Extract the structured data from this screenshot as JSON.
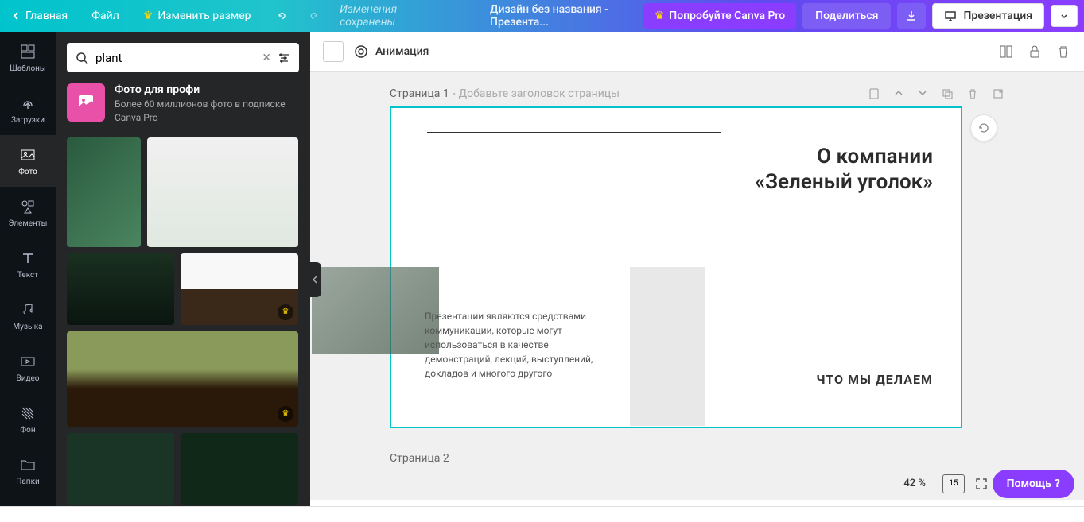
{
  "header": {
    "home": "Главная",
    "file": "Файл",
    "resize": "Изменить размер",
    "saved": "Изменения сохранены",
    "doc_title": "Дизайн без названия - Презента...",
    "try_pro": "Попробуйте Canva Pro",
    "share": "Поделиться",
    "present": "Презентация"
  },
  "rail": {
    "templates": "Шаблоны",
    "uploads": "Загрузки",
    "photos": "Фото",
    "elements": "Элементы",
    "text": "Текст",
    "music": "Музыка",
    "video": "Видео",
    "background": "Фон",
    "folders": "Папки"
  },
  "search": {
    "value": "plant"
  },
  "promo": {
    "title": "Фото для профи",
    "subtitle": "Более 60 миллионов фото в подписке Canva Pro"
  },
  "toolbar": {
    "animation": "Анимация"
  },
  "page1": {
    "label": "Страница 1",
    "placeholder": "Добавьте заголовок страницы"
  },
  "slide": {
    "title_line1": "О компании",
    "title_line2": "«Зеленый уголок»",
    "body": "Презентации являются средствами коммуникации, которые могут использоваться в качестве демонстраций, лекций, выступлений, докладов и многого другого",
    "caption": "ЧТО МЫ ДЕЛАЕМ"
  },
  "page2": {
    "label": "Страница 2"
  },
  "zoom": {
    "level": "42 %",
    "pages": "15"
  },
  "help": "Помощь"
}
